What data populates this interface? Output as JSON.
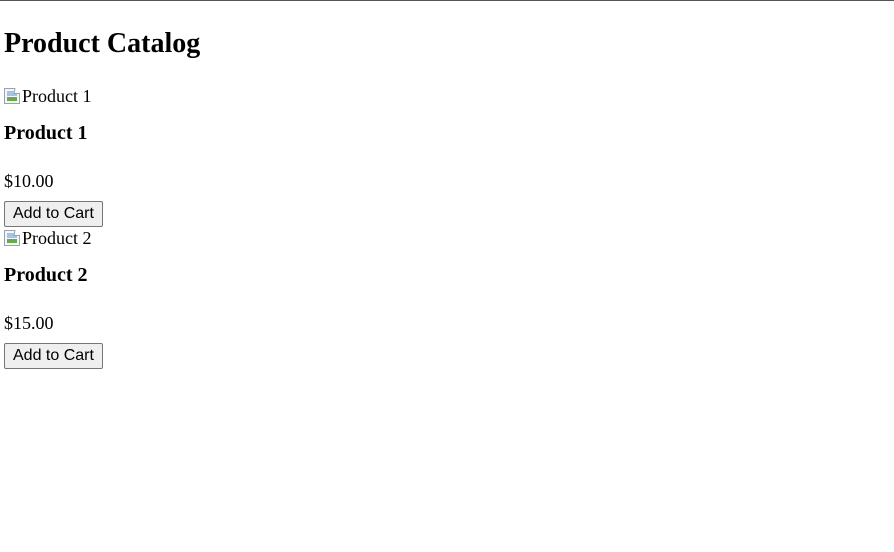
{
  "page": {
    "title": "Product Catalog"
  },
  "products": [
    {
      "image_alt": "Product 1",
      "image_icon": "broken-image-icon",
      "name": "Product 1",
      "price": "$10.00",
      "button_label": "Add to Cart"
    },
    {
      "image_alt": "Product 2",
      "image_icon": "broken-image-icon",
      "name": "Product 2",
      "price": "$15.00",
      "button_label": "Add to Cart"
    }
  ]
}
